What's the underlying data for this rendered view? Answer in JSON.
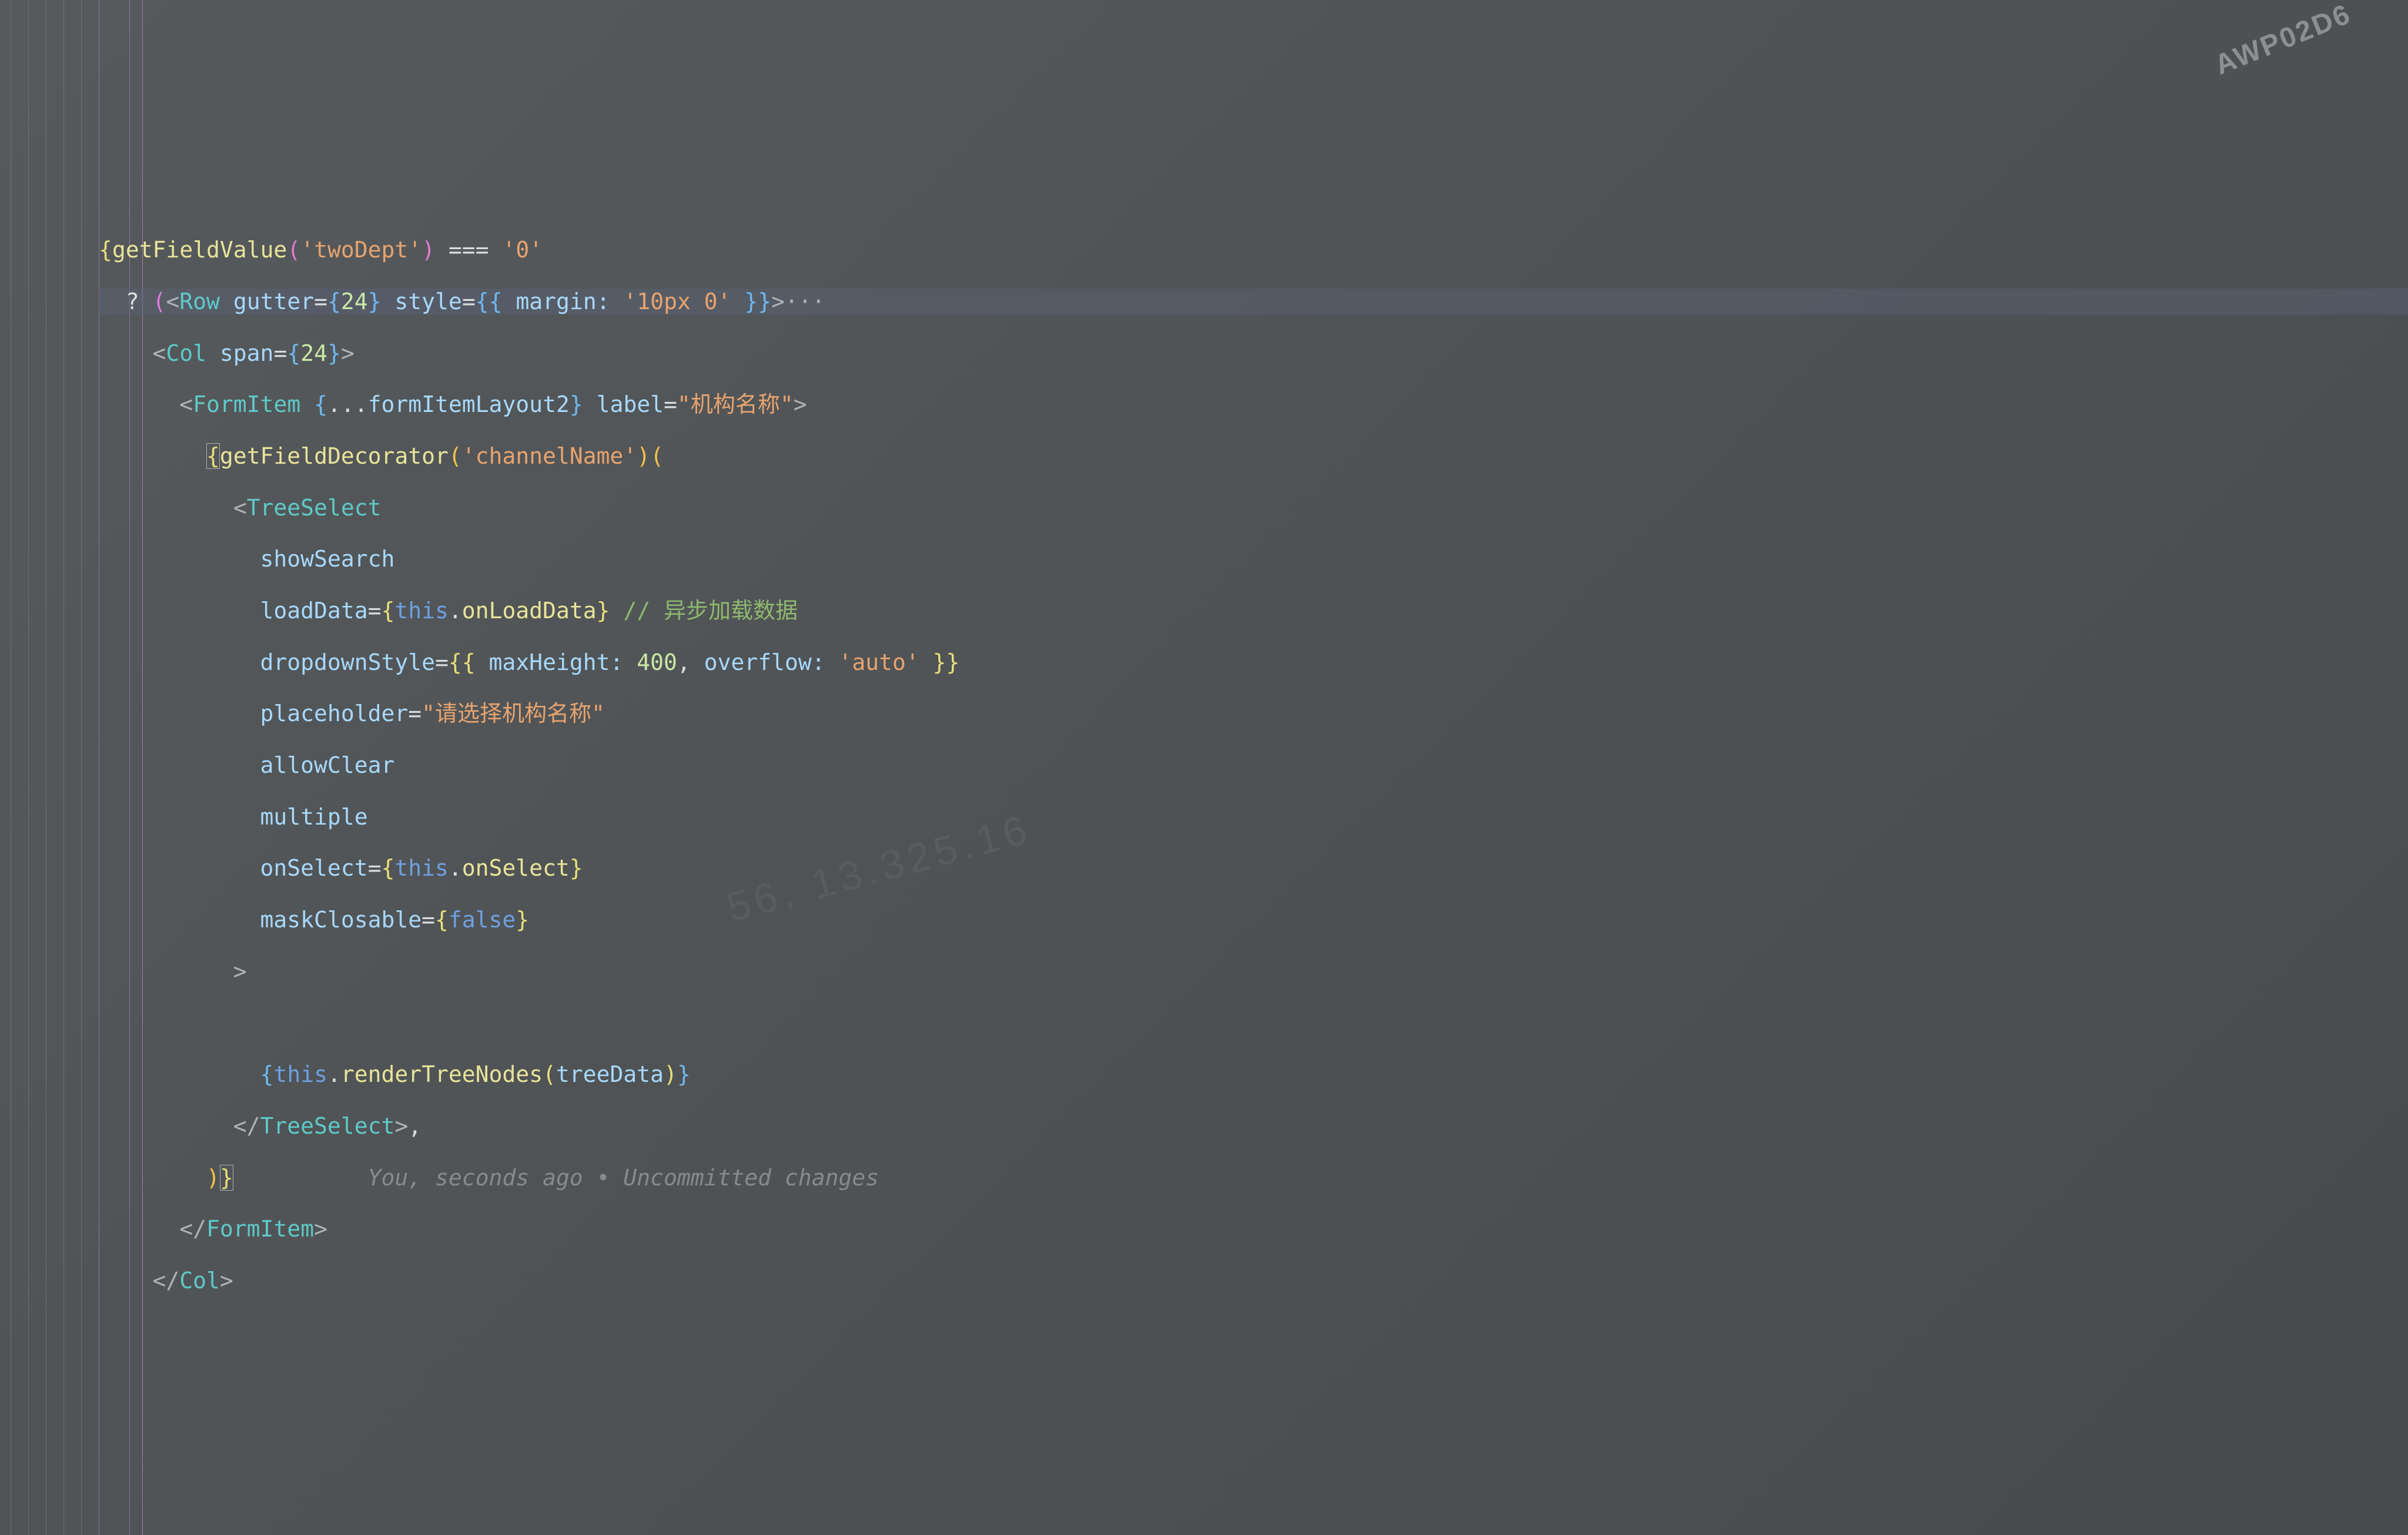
{
  "watermark": {
    "corner": "AWP02D6",
    "center": "56, 13.325.16"
  },
  "gitlens": {
    "text": "You, seconds ago • Uncommitted changes"
  },
  "code": {
    "l1": {
      "brace_open": "{",
      "fn": "getFieldValue",
      "po": "(",
      "arg": "'twoDept'",
      "pc": ")",
      "eq": " === ",
      "val": "'0'"
    },
    "l2": {
      "lead": "  ? ",
      "po": "(",
      "lt": "<",
      "tag": "Row",
      "a1": " gutter",
      "eq1": "=",
      "b1o": "{",
      "n1": "24",
      "b1c": "}",
      "a2": " style",
      "eq2": "=",
      "b2o": "{{ ",
      "k2": "margin:",
      "v2": " '10px 0' ",
      "b2c": "}}",
      "gt": ">",
      "fold": "···"
    },
    "l3": {
      "ind": "    ",
      "lt": "<",
      "tag": "Col",
      "a1": " span",
      "eq": "=",
      "bo": "{",
      "n": "24",
      "bc": "}",
      "gt": ">"
    },
    "l4": {
      "ind": "      ",
      "lt": "<",
      "tag": "FormItem",
      "sp": " ",
      "bo": "{",
      "spread": "...",
      "var": "formItemLayout2",
      "bc": "}",
      "a2": " label",
      "eq": "=",
      "v2": "\"机构名称\"",
      "gt": ">"
    },
    "l5": {
      "ind": "        ",
      "box": "{",
      "fn": "getFieldDecorator",
      "po": "(",
      "arg": "'channelName'",
      "pc": ")",
      "po2": "("
    },
    "l6": {
      "ind": "          ",
      "lt": "<",
      "tag": "TreeSelect"
    },
    "l7": {
      "ind": "            ",
      "attr": "showSearch"
    },
    "l8": {
      "ind": "            ",
      "attr": "loadData",
      "eq": "=",
      "bo": "{",
      "this": "this",
      "dot": ".",
      "prop": "onLoadData",
      "bc": "}",
      "cm": " // 异步加载数据"
    },
    "l9": {
      "ind": "            ",
      "attr": "dropdownStyle",
      "eq": "=",
      "b2o": "{{ ",
      "k1": "maxHeight:",
      "v1": " 400",
      "c": ", ",
      "k2": "overflow:",
      "v2": " 'auto' ",
      "b2c": "}}"
    },
    "l10": {
      "ind": "            ",
      "attr": "placeholder",
      "eq": "=",
      "v": "\"请选择机构名称\""
    },
    "l11": {
      "ind": "            ",
      "attr": "allowClear"
    },
    "l12": {
      "ind": "            ",
      "attr": "multiple"
    },
    "l13": {
      "ind": "            ",
      "attr": "onSelect",
      "eq": "=",
      "bo": "{",
      "this": "this",
      "dot": ".",
      "prop": "onSelect",
      "bc": "}"
    },
    "l14": {
      "ind": "            ",
      "attr": "maskClosable",
      "eq": "=",
      "bo": "{",
      "val": "false",
      "bc": "}"
    },
    "l15": {
      "ind": "          ",
      "gt": ">"
    },
    "l16": {
      "ind": "            "
    },
    "l17": {
      "ind": "            ",
      "bo": "{",
      "this": "this",
      "dot": ".",
      "fn": "renderTreeNodes",
      "po": "(",
      "arg": "treeData",
      "pc": ")",
      "bc": "}"
    },
    "l18": {
      "ind": "          ",
      "lt": "</",
      "tag": "TreeSelect",
      "gt": ">",
      "comma": ","
    },
    "l19": {
      "ind": "        ",
      "pc": ")",
      "box": "}",
      "lens_pad": "          "
    },
    "l20": {
      "ind": "      ",
      "lt": "</",
      "tag": "FormItem",
      "gt": ">"
    },
    "l21": {
      "ind": "    ",
      "lt": "</",
      "tag": "Col",
      "gt": ">"
    }
  }
}
